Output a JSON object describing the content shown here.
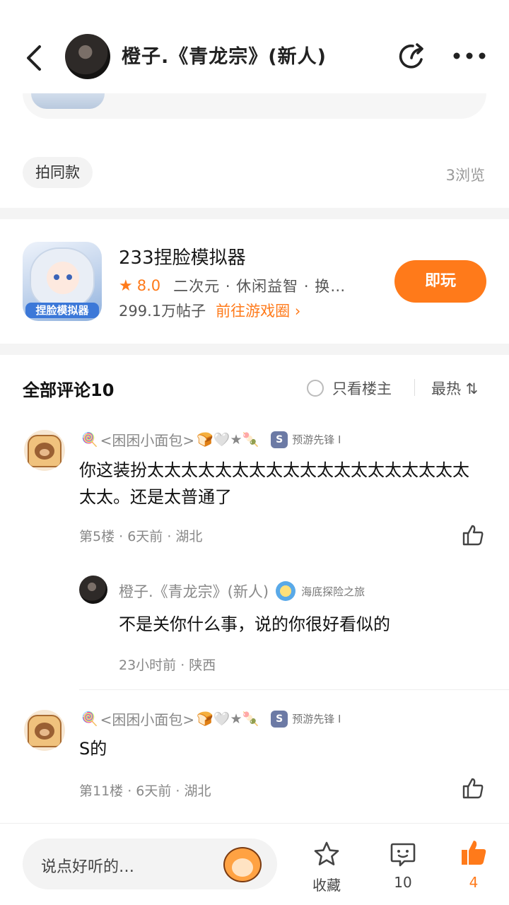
{
  "header": {
    "author_name": "橙子.《青龙宗》(新人)",
    "back_icon": "chevron-left-icon",
    "share_icon": "share-icon",
    "more_icon": "more-icon"
  },
  "post": {
    "tag": "拍同款",
    "views": "3浏览"
  },
  "game": {
    "icon_label": "捏脸模拟器",
    "title": "233捏脸模拟器",
    "rating": "8.0",
    "tags": "二次元 · 休闲益智 · 换…",
    "posts": "299.1万帖子",
    "link": "前往游戏圈",
    "link_arrow": "›",
    "play": "即玩",
    "accent": "#ff7a1a"
  },
  "comments_header": {
    "title": "全部评论10",
    "only_op": "只看楼主",
    "sort": "最热 ⇅"
  },
  "comments": [
    {
      "name": "<困困小面包>",
      "decor_pre": "🍭",
      "decor_post": "🍞🤍★🍡",
      "badge": "S",
      "badge_text": "预游先锋 I",
      "body": "你这装扮太太太太太太太太太太太太太太太太太太太太太。还是太普通了",
      "meta": "第5楼 · 6天前 · 湖北",
      "reply": {
        "name": "橙子.《青龙宗》(新人)",
        "badge_text": "海底探险之旅",
        "body": "不是关你什么事，说的你很好看似的",
        "meta": "23小时前 · 陕西"
      }
    },
    {
      "name": "<困困小面包>",
      "decor_pre": "🍭",
      "decor_post": "🍞🤍★🍡",
      "badge": "S",
      "badge_text": "预游先锋 I",
      "body": "S的",
      "meta": "第11楼 · 6天前 · 湖北"
    }
  ],
  "bottom_bar": {
    "input_placeholder": "说点好听的…",
    "favorite": "收藏",
    "comment_count": "10",
    "like_count": "4"
  }
}
